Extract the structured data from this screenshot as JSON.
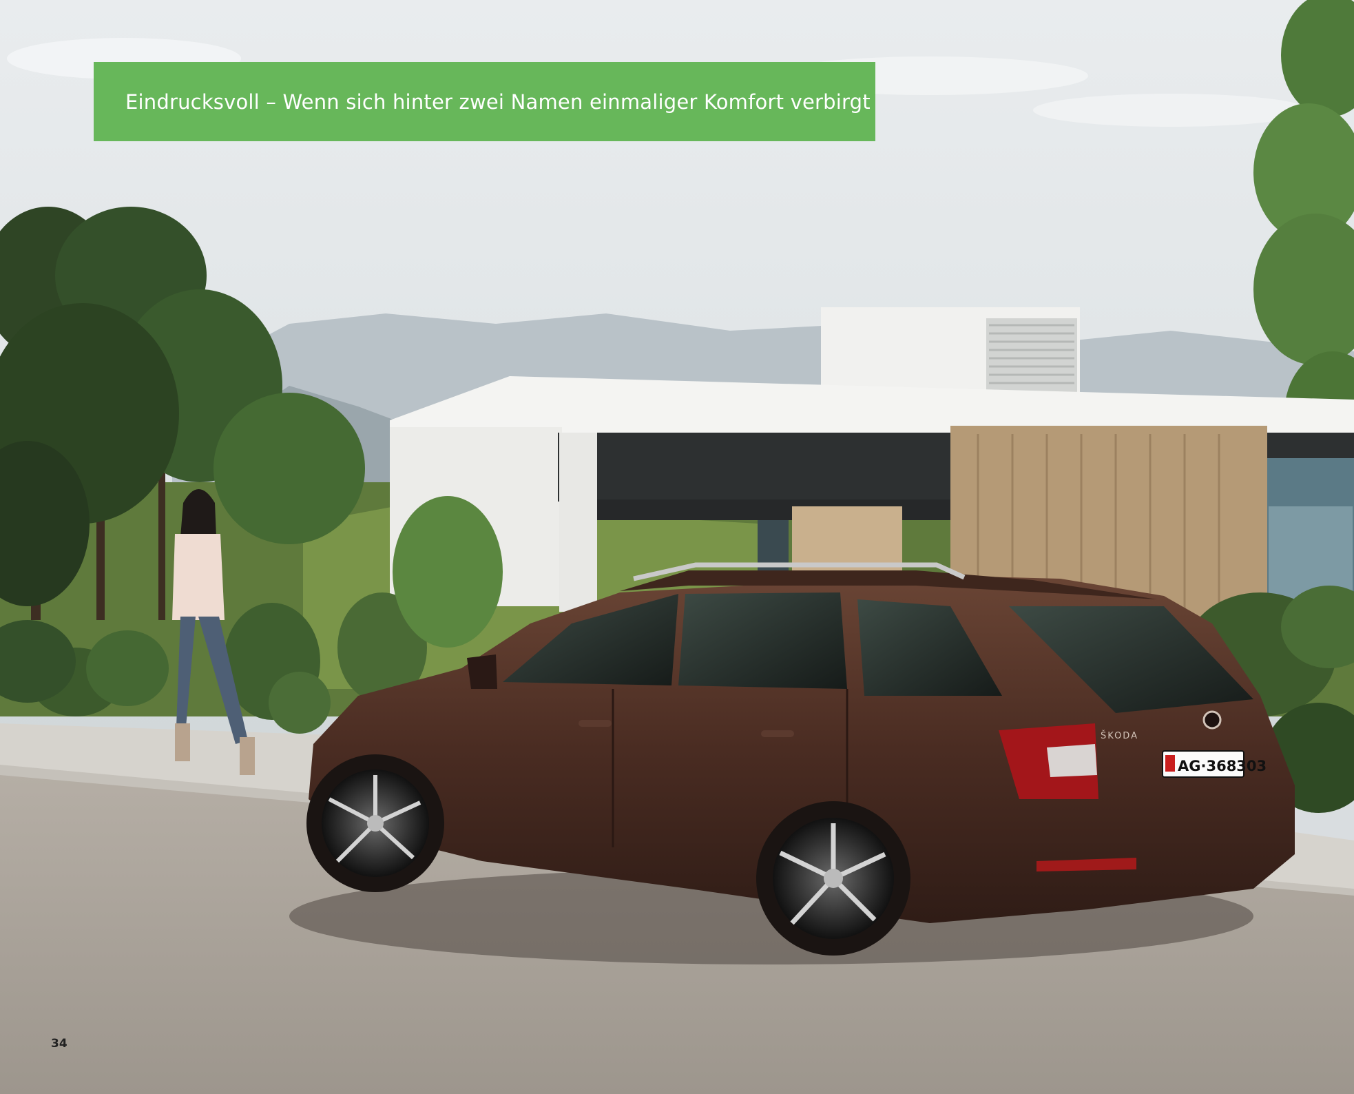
{
  "page": {
    "title": "Eindrucksvoll – Wenn sich hinter zwei Namen einmaliger Komfort verbirgt",
    "page_number": "34"
  },
  "photo": {
    "brand_lettering": "ŠKODA",
    "license_plate": "AG·368303"
  },
  "colors": {
    "banner": "#67b75a",
    "car_body": "#4a2c22",
    "sky": "#dfe4e6",
    "road": "#a59e95"
  }
}
